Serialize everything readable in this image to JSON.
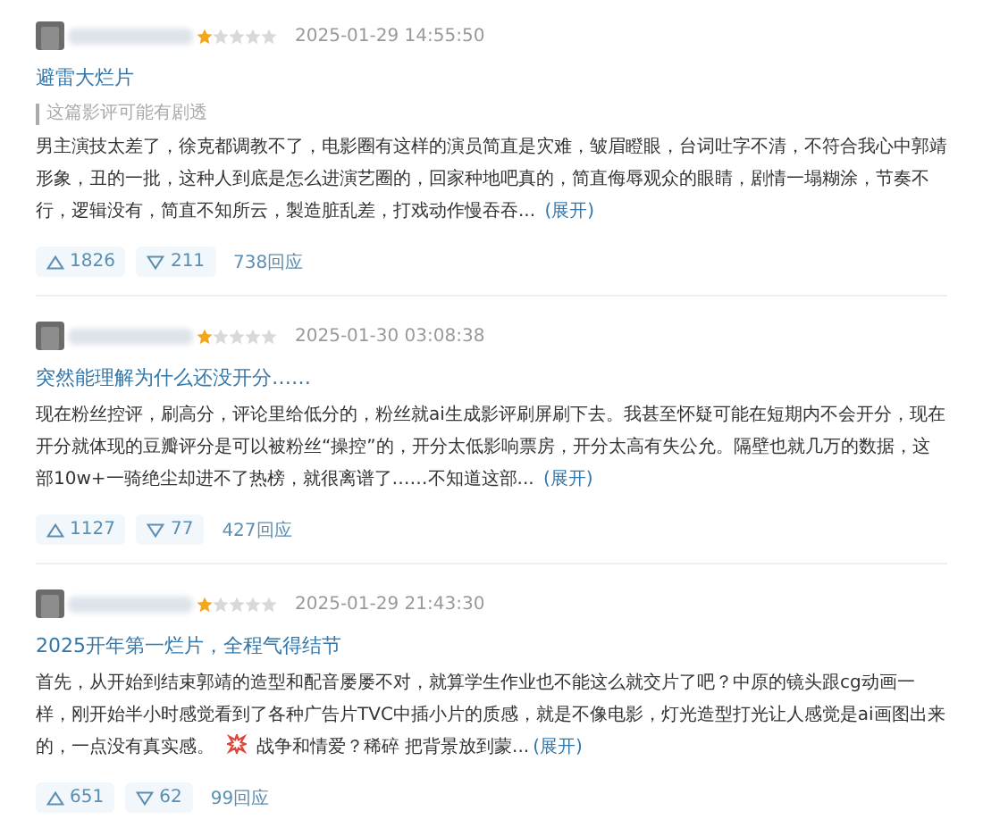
{
  "reviews": [
    {
      "stars": 1,
      "time": "2025-01-29 14:55:50",
      "title": "避雷大烂片",
      "spoiler": "这篇影评可能有剧透",
      "text": "男主演技太差了，徐克都调教不了，电影圈有这样的演员简直是灾难，皱眉瞪眼，台词吐字不清，不符合我心中郭靖形象，丑的一批，这种人到底是怎么进演艺圈的，回家种地吧真的，简直侮辱观众的眼睛，剧情一塌糊涂，节奏不行，逻辑没有，简直不知所云，製造脏乱差，打戏动作慢吞吞...",
      "expand": "(展开)",
      "up": "1826",
      "down": "211",
      "replies": "738回应"
    },
    {
      "stars": 1,
      "time": "2025-01-30 03:08:38",
      "title": "突然能理解为什么还没开分……",
      "text": "现在粉丝控评，刷高分，评论里给低分的，粉丝就ai生成影评刷屏刷下去。我甚至怀疑可能在短期内不会开分，现在开分就体现的豆瓣评分是可以被粉丝“操控”的，开分太低影响票房，开分太高有失公允。隔壁也就几万的数据，这部10w+一骑绝尘却进不了热榜，就很离谱了……不知道这部...",
      "expand": "(展开)",
      "up": "1127",
      "down": "77",
      "replies": "427回应"
    },
    {
      "stars": 1,
      "time": "2025-01-29 21:43:30",
      "title": "2025开年第一烂片，全程气得结节",
      "text": "首先，从开始到结束郭靖的造型和配音屡屡不对，就算学生作业也不能这么就交片了吧？中原的镜头跟cg动画一样，刚开始半小时感觉看到了各种广告片TVC中插小片的质感，就是不像电影，灯光造型打光让人感觉是ai画图出来的，一点没有真实感。",
      "after_icon": "战争和情爱？稀碎 把背景放到蒙...",
      "expand": "(展开)",
      "up": "651",
      "down": "62",
      "replies": "99回应"
    }
  ]
}
